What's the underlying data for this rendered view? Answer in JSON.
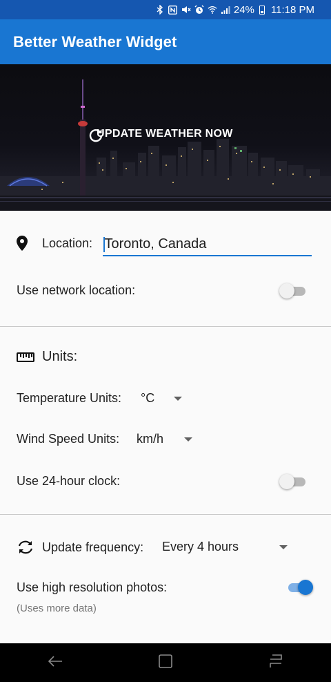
{
  "status_bar": {
    "battery": "24%",
    "time": "11:18 PM",
    "icons": [
      "bluetooth-icon",
      "nfc-icon",
      "mute-icon",
      "alarm-icon",
      "wifi-icon",
      "signal-icon",
      "battery-icon"
    ]
  },
  "app_bar": {
    "title": "Better Weather Widget"
  },
  "hero": {
    "update_label": "UPDATE WEATHER NOW"
  },
  "location": {
    "label": "Location:",
    "value": "Toronto, Canada",
    "network_label": "Use network location:",
    "network_enabled": false
  },
  "units": {
    "heading": "Units:",
    "temperature_label": "Temperature Units:",
    "temperature_value": "°C",
    "wind_label": "Wind Speed Units:",
    "wind_value": "km/h",
    "clock_label": "Use 24-hour clock:",
    "clock_enabled": false
  },
  "update": {
    "frequency_label": "Update frequency:",
    "frequency_value": "Every 4 hours",
    "hires_label": "Use high resolution photos:",
    "hires_note": "(Uses more data)",
    "hires_enabled": true
  },
  "colors": {
    "status_bar": "#1557b0",
    "app_bar": "#1976d2",
    "accent": "#1976d2",
    "background": "#fafafa"
  }
}
